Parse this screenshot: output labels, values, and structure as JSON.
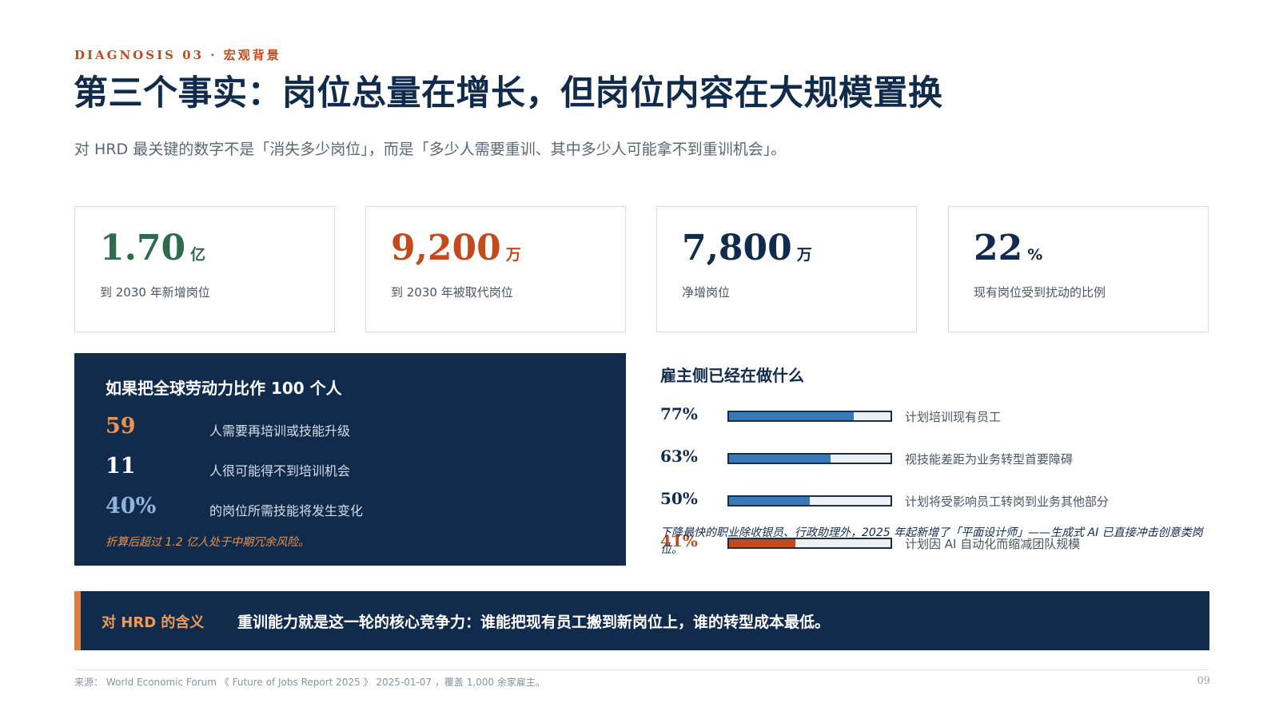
{
  "header": {
    "eyebrow": "DIAGNOSIS 03 · 宏观背景",
    "title": "第三个事实：岗位总量在增长，但岗位内容在大规模置换",
    "subtitle": "对 HRD 最关键的数字不是「消失多少岗位」，而是「多少人需要重训、其中多少人可能拿不到重训机会」。"
  },
  "stats": [
    {
      "number": "1.70",
      "unit": "亿",
      "label": "到 2030 年新增岗位",
      "color": "#2e6b4a"
    },
    {
      "number": "9,200",
      "unit": "万",
      "label": "到 2030 年被取代岗位",
      "color": "#c24a1c"
    },
    {
      "number": "7,800",
      "unit": "万",
      "label": "净增岗位",
      "color": "#112b4c"
    },
    {
      "number": "22",
      "unit": "%",
      "label": "现有岗位受到扰动的比例",
      "color": "#112b4c"
    }
  ],
  "workforce": {
    "title": "如果把全球劳动力比作 100 个人",
    "rows": [
      {
        "number": "59",
        "text": "人需要再培训或技能升级",
        "color": "#f0924f"
      },
      {
        "number": "11",
        "text": "人很可能得不到培训机会",
        "color": "#ffffff"
      },
      {
        "number": "40%",
        "text": "的岗位所需技能将发生变化",
        "color": "#8fb4dc"
      }
    ],
    "note": "折算后超过 1.2 亿人处于中期冗余风险。"
  },
  "employers": {
    "title": "雇主侧已经在做什么",
    "bars": [
      {
        "pct_label": "77%",
        "value": 77,
        "label": "计划培训现有员工",
        "color": "#3a79b8"
      },
      {
        "pct_label": "63%",
        "value": 63,
        "label": "视技能差距为业务转型首要障碍",
        "color": "#3a79b8"
      },
      {
        "pct_label": "50%",
        "value": 50,
        "label": "计划将受影响员工转岗到业务其他部分",
        "color": "#3a79b8"
      },
      {
        "pct_label": "41%",
        "value": 41,
        "label": "计划因 AI 自动化而缩减团队规模",
        "color": "#c24a1c"
      }
    ],
    "note": "下降最快的职业除收银员、行政助理外，2025 年起新增了「平面设计师」——生成式 AI 已直接冲击创意类岗位。"
  },
  "hrd": {
    "label": "对 HRD 的含义",
    "text": "重训能力就是这一轮的核心竞争力：谁能把现有员工搬到新岗位上，谁的转型成本最低。"
  },
  "footer": {
    "source": "来源： World Economic Forum 《 Future of Jobs Report 2025 》 2025-01-07 ，覆盖 1,000 余家雇主。",
    "page": "09"
  }
}
